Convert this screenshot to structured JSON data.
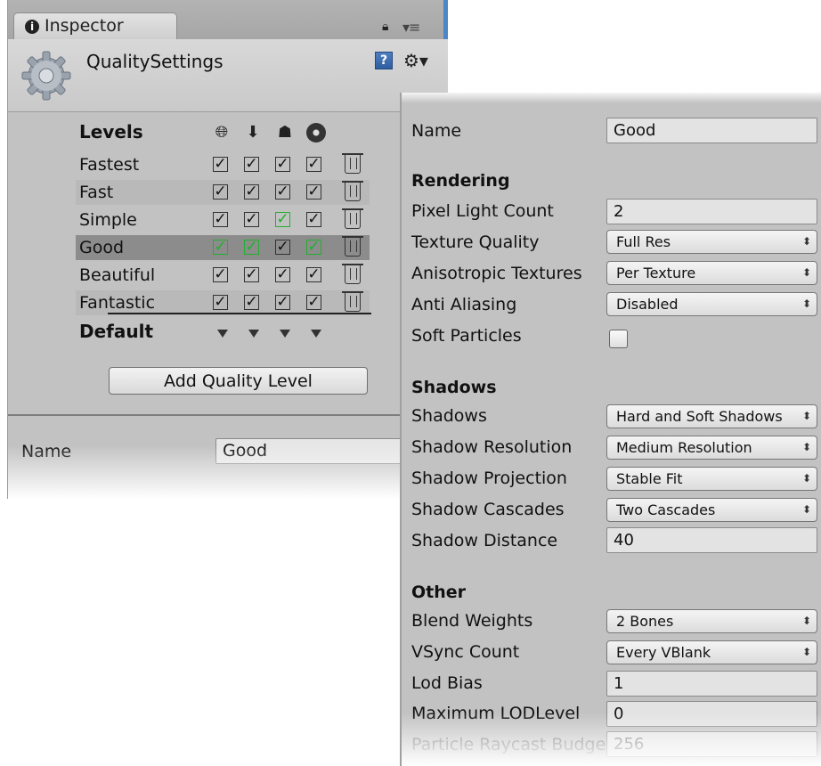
{
  "inspector": {
    "tab_label": "Inspector",
    "title": "QualitySettings",
    "help_glyph": "?",
    "levels_heading": "Levels",
    "platform_icons": [
      "globe-icon",
      "download-icon",
      "android-icon",
      "disc-icon"
    ],
    "levels": [
      {
        "name": "Fastest",
        "checks": [
          true,
          true,
          true,
          true
        ],
        "green": [
          false,
          false,
          false,
          false
        ]
      },
      {
        "name": "Fast",
        "checks": [
          true,
          true,
          true,
          true
        ],
        "green": [
          false,
          false,
          false,
          false
        ]
      },
      {
        "name": "Simple",
        "checks": [
          true,
          true,
          true,
          true
        ],
        "green": [
          false,
          false,
          true,
          false
        ]
      },
      {
        "name": "Good",
        "checks": [
          true,
          true,
          true,
          true
        ],
        "green": [
          true,
          true,
          false,
          true
        ],
        "selected": true
      },
      {
        "name": "Beautiful",
        "checks": [
          true,
          true,
          true,
          true
        ],
        "green": [
          false,
          false,
          false,
          false
        ]
      },
      {
        "name": "Fantastic",
        "checks": [
          true,
          true,
          true,
          true
        ],
        "green": [
          false,
          false,
          false,
          false
        ]
      }
    ],
    "default_label": "Default",
    "add_button_label": "Add Quality Level",
    "name_label": "Name",
    "name_value": "Good",
    "colors": {
      "panel": "#c2c2c2",
      "selected_row": "#8c8c8c",
      "check_green": "#22b02c",
      "tab_accent": "#4a86c8"
    }
  },
  "details": {
    "name_label": "Name",
    "name_value": "Good",
    "rendering": {
      "heading": "Rendering",
      "pixel_light_count_label": "Pixel Light Count",
      "pixel_light_count_value": "2",
      "texture_quality_label": "Texture Quality",
      "texture_quality_value": "Full Res",
      "anisotropic_label": "Anisotropic Textures",
      "anisotropic_value": "Per Texture",
      "anti_aliasing_label": "Anti Aliasing",
      "anti_aliasing_value": "Disabled",
      "soft_particles_label": "Soft Particles",
      "soft_particles_checked": false
    },
    "shadows": {
      "heading": "Shadows",
      "shadows_label": "Shadows",
      "shadows_value": "Hard and Soft Shadows",
      "resolution_label": "Shadow Resolution",
      "resolution_value": "Medium Resolution",
      "projection_label": "Shadow Projection",
      "projection_value": "Stable Fit",
      "cascades_label": "Shadow Cascades",
      "cascades_value": "Two Cascades",
      "distance_label": "Shadow Distance",
      "distance_value": "40"
    },
    "other": {
      "heading": "Other",
      "blend_weights_label": "Blend Weights",
      "blend_weights_value": "2 Bones",
      "vsync_label": "VSync Count",
      "vsync_value": "Every VBlank",
      "lod_bias_label": "Lod Bias",
      "lod_bias_value": "1",
      "max_lod_label": "Maximum LODLevel",
      "max_lod_value": "0",
      "particle_raycast_label": "Particle Raycast Budget",
      "particle_raycast_value": "256"
    },
    "dropdown_arrow": "⬍"
  }
}
